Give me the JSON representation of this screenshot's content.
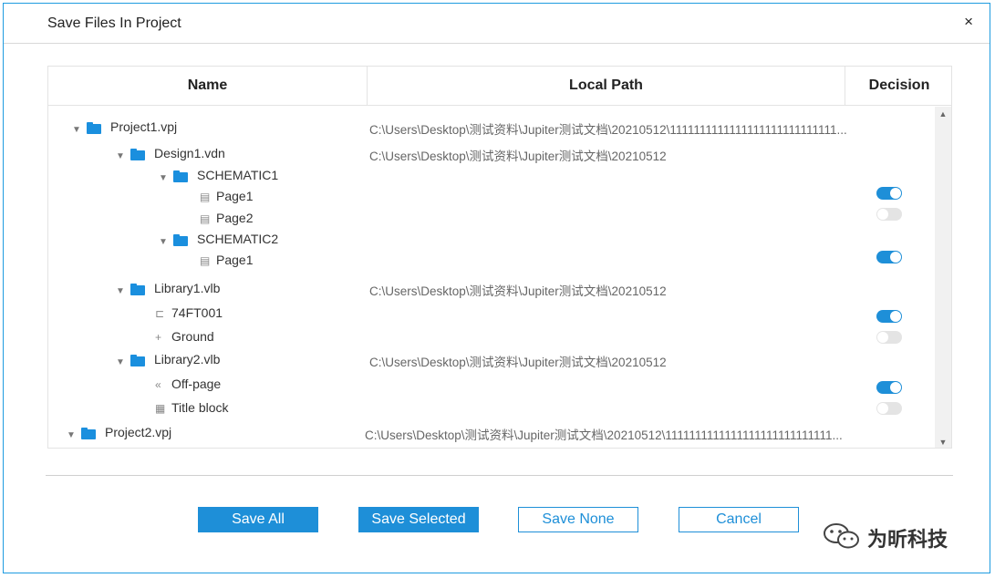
{
  "dialog": {
    "title": "Save Files In Project",
    "close_glyph": "×"
  },
  "table": {
    "columns": {
      "name": "Name",
      "path": "Local Path",
      "decision": "Decision"
    },
    "rows": [
      {
        "label": "Project1.vpj",
        "icon": "folder-icon",
        "expand": "▼",
        "path": "C:\\Users\\Desktop\\测试资料\\Jupiter测试文档\\20210512\\1111111111111111111111111111..."
      },
      {
        "label": "Design1.vdn",
        "icon": "folder-icon",
        "expand": "▼",
        "path": "C:\\Users\\Desktop\\测试资料\\Jupiter测试文档\\20210512"
      },
      {
        "label": "SCHEMATIC1",
        "icon": "folder-icon",
        "expand": "▼"
      },
      {
        "label": "Page1",
        "icon": "page-icon",
        "glyph": "▤",
        "toggle": "on"
      },
      {
        "label": "Page2",
        "icon": "page-icon",
        "glyph": "▤",
        "toggle": "off"
      },
      {
        "label": "SCHEMATIC2",
        "icon": "folder-icon",
        "expand": "▼"
      },
      {
        "label": "Page1",
        "icon": "page-icon",
        "glyph": "▤",
        "toggle": "on"
      },
      {
        "label": "Library1.vlb",
        "icon": "folder-icon",
        "expand": "▼",
        "path": "C:\\Users\\Desktop\\测试资料\\Jupiter测试文档\\20210512"
      },
      {
        "label": "74FT001",
        "icon": "component-icon",
        "glyph": "⊏",
        "toggle": "on"
      },
      {
        "label": "Ground",
        "icon": "ground-icon",
        "glyph": "+",
        "toggle": "off"
      },
      {
        "label": "Library2.vlb",
        "icon": "folder-icon",
        "expand": "▼",
        "path": "C:\\Users\\Desktop\\测试资料\\Jupiter测试文档\\20210512"
      },
      {
        "label": "Off-page",
        "icon": "offpage-icon",
        "glyph": "«",
        "toggle": "on"
      },
      {
        "label": "Title block",
        "icon": "titleblock-icon",
        "glyph": "▦",
        "toggle": "off"
      },
      {
        "label": "Project2.vpj",
        "icon": "folder-icon",
        "expand": "▼",
        "path": "C:\\Users\\Desktop\\测试资料\\Jupiter测试文档\\20210512\\1111111111111111111111111111..."
      }
    ]
  },
  "scrollbar": {
    "up_glyph": "▲",
    "down_glyph": "▼"
  },
  "buttons": {
    "save_all": "Save All",
    "save_selected": "Save Selected",
    "save_none": "Save None",
    "cancel": "Cancel"
  },
  "watermark": {
    "text": "为昕科技"
  },
  "colors": {
    "accent": "#1e8fd8",
    "toggle_off": "#e4e4e4",
    "folder": "#1a8fde"
  }
}
